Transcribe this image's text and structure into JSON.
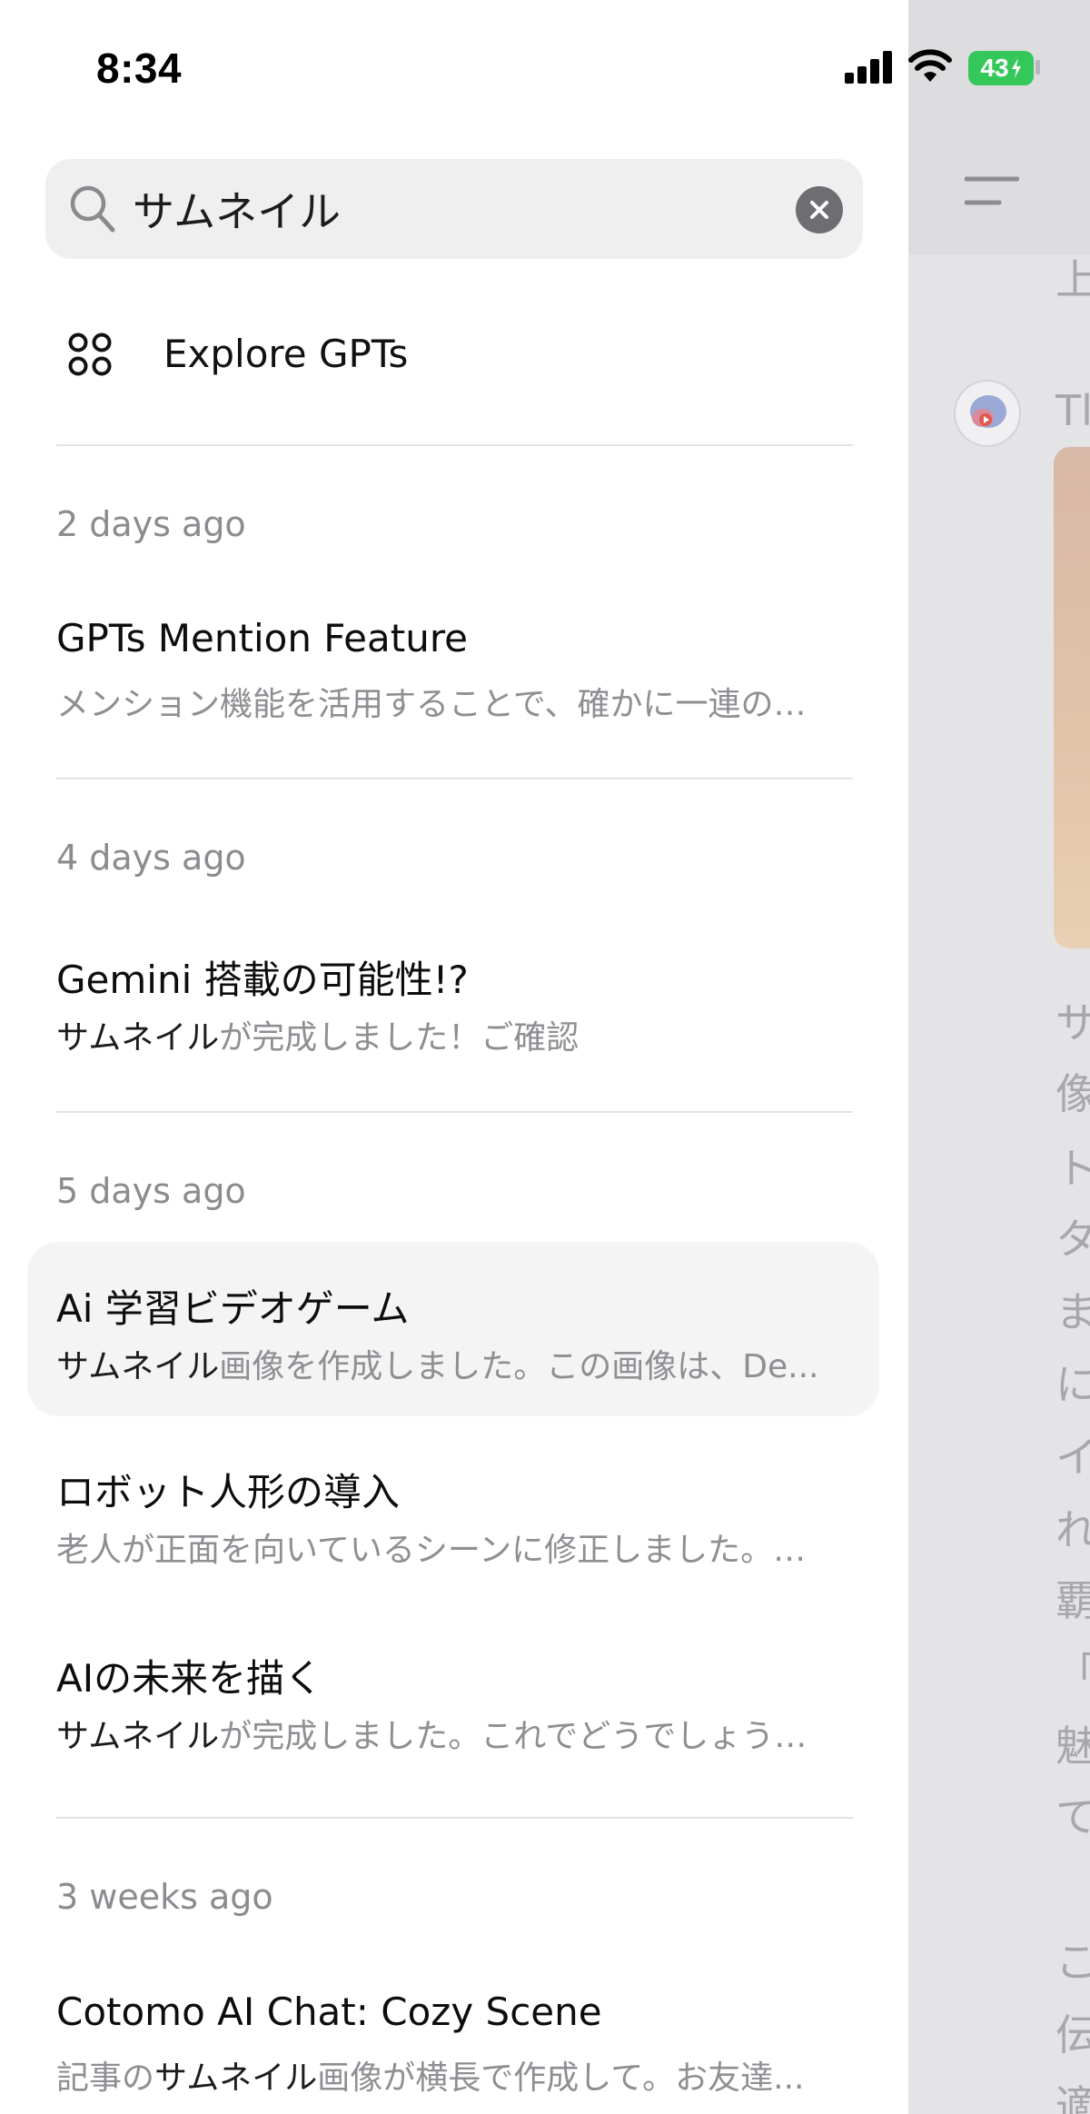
{
  "status_bar": {
    "time": "8:34",
    "battery": "43"
  },
  "search": {
    "query": "サムネイル",
    "placeholder": "Search"
  },
  "explore": {
    "label": "Explore GPTs"
  },
  "sections": [
    {
      "label": "2 days ago",
      "chats": [
        {
          "title": "GPTs Mention Feature",
          "snippet_pre": "",
          "snippet_match": "",
          "snippet_post": "メンション機能を活用することで、確かに一連の…"
        }
      ]
    },
    {
      "label": "4 days ago",
      "chats": [
        {
          "title": "Gemini 搭載の可能性!?",
          "snippet_pre": "",
          "snippet_match": "サムネイル",
          "snippet_post": "が完成しました！ご確認"
        }
      ]
    },
    {
      "label": "5 days ago",
      "chats": [
        {
          "title": "Ai 学習ビデオゲーム",
          "snippet_pre": "",
          "snippet_match": "サムネイル",
          "snippet_post": "画像を作成しました。この画像は、De..."
        },
        {
          "title": "ロボット人形の導入",
          "snippet_pre": "",
          "snippet_match": "",
          "snippet_post": "老人が正面を向いているシーンに修正しました。…"
        },
        {
          "title": "AIの未来を描く",
          "snippet_pre": "",
          "snippet_match": "サムネイル",
          "snippet_post": "が完成しました。これでどうでしょう…"
        }
      ]
    },
    {
      "label": "3 weeks ago",
      "chats": [
        {
          "title": "Cotomo AI Chat: Cozy Scene",
          "snippet_pre": "記事の",
          "snippet_match": "サムネイル",
          "snippet_post": "画像が横長で作成して。お友達..."
        }
      ]
    }
  ],
  "background_chat": {
    "line_top": "上",
    "sender_fragment": "Tl",
    "body_lines": [
      "サ",
      "像",
      "ト",
      "タ",
      "ま",
      "に",
      "イ",
      "れ",
      "覇",
      "「S",
      "魅",
      "て",
      "",
      "こ",
      "伝",
      "適"
    ]
  },
  "colors": {
    "battery_green": "#34c759",
    "highlight_text": "#1c1c1e",
    "muted_text": "#8e8e93"
  }
}
